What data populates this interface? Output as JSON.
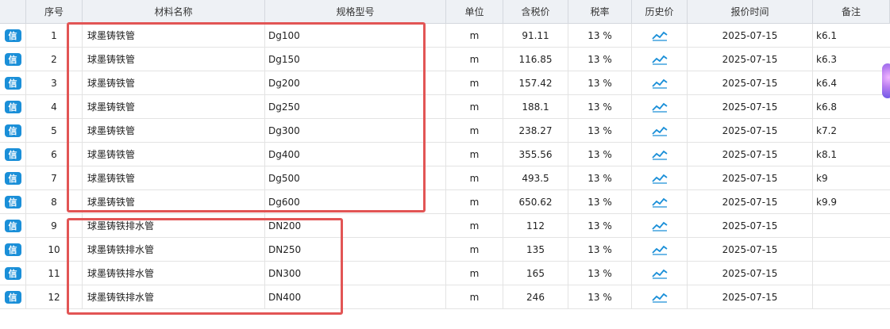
{
  "headers": [
    "",
    "序号",
    "材料名称",
    "规格型号",
    "单位",
    "含税价",
    "税率",
    "历史价",
    "报价时间",
    "备注"
  ],
  "badge_label": "信",
  "history_icon": "line-chart-icon",
  "accent_color": "#1a8fd8",
  "highlight_color": "#e25555",
  "rows": [
    {
      "no": "1",
      "name": "球墨铸铁管",
      "spec": "Dg100",
      "unit": "m",
      "price": "91.11",
      "tax": "13 %",
      "date": "2025-07-15",
      "note": "k6.1"
    },
    {
      "no": "2",
      "name": "球墨铸铁管",
      "spec": "Dg150",
      "unit": "m",
      "price": "116.85",
      "tax": "13 %",
      "date": "2025-07-15",
      "note": "k6.3"
    },
    {
      "no": "3",
      "name": "球墨铸铁管",
      "spec": "Dg200",
      "unit": "m",
      "price": "157.42",
      "tax": "13 %",
      "date": "2025-07-15",
      "note": "k6.4"
    },
    {
      "no": "4",
      "name": "球墨铸铁管",
      "spec": "Dg250",
      "unit": "m",
      "price": "188.1",
      "tax": "13 %",
      "date": "2025-07-15",
      "note": "k6.8"
    },
    {
      "no": "5",
      "name": "球墨铸铁管",
      "spec": "Dg300",
      "unit": "m",
      "price": "238.27",
      "tax": "13 %",
      "date": "2025-07-15",
      "note": "k7.2"
    },
    {
      "no": "6",
      "name": "球墨铸铁管",
      "spec": "Dg400",
      "unit": "m",
      "price": "355.56",
      "tax": "13 %",
      "date": "2025-07-15",
      "note": "k8.1"
    },
    {
      "no": "7",
      "name": "球墨铸铁管",
      "spec": "Dg500",
      "unit": "m",
      "price": "493.5",
      "tax": "13 %",
      "date": "2025-07-15",
      "note": "k9"
    },
    {
      "no": "8",
      "name": "球墨铸铁管",
      "spec": "Dg600",
      "unit": "m",
      "price": "650.62",
      "tax": "13 %",
      "date": "2025-07-15",
      "note": "k9.9"
    },
    {
      "no": "9",
      "name": "球墨铸铁排水管",
      "spec": "DN200",
      "unit": "m",
      "price": "112",
      "tax": "13 %",
      "date": "2025-07-15",
      "note": ""
    },
    {
      "no": "10",
      "name": "球墨铸铁排水管",
      "spec": "DN250",
      "unit": "m",
      "price": "135",
      "tax": "13 %",
      "date": "2025-07-15",
      "note": ""
    },
    {
      "no": "11",
      "name": "球墨铸铁排水管",
      "spec": "DN300",
      "unit": "m",
      "price": "165",
      "tax": "13 %",
      "date": "2025-07-15",
      "note": ""
    },
    {
      "no": "12",
      "name": "球墨铸铁排水管",
      "spec": "DN400",
      "unit": "m",
      "price": "246",
      "tax": "13 %",
      "date": "2025-07-15",
      "note": ""
    }
  ]
}
